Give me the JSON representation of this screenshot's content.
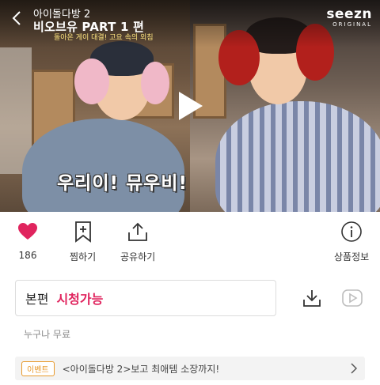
{
  "player": {
    "program_name": "아이돌다방 2",
    "episode_title": "비오브유 PART 1 편",
    "scene_caption": "돌아온 게이 대결! 고요 속의 외침",
    "subtitle_caption": "우리이! 뮤우비!",
    "brand": {
      "name": "seezn",
      "sub": "ORIGINAL"
    },
    "icons": {
      "back": "chevron-left-icon",
      "play": "play-icon"
    }
  },
  "actions": {
    "like": {
      "count": "186",
      "icon": "heart-icon",
      "color": "#e0245e"
    },
    "bookmark": {
      "label": "찜하기",
      "icon": "bookmark-plus-icon"
    },
    "share": {
      "label": "공유하기",
      "icon": "share-icon"
    },
    "product_info": {
      "label": "상품정보",
      "icon": "info-icon"
    }
  },
  "watch": {
    "type": "본편",
    "status": "시청가능",
    "status_color": "#e0245e",
    "download_icon": "download-icon",
    "play_icon": "play-outline-icon",
    "access_note": "누구나 무료"
  },
  "event": {
    "badge": "이벤트",
    "badge_color": "#e89a2c",
    "text": "<아이돌다방 2>보고 최애템 소장까지!",
    "chevron_icon": "chevron-right-icon"
  }
}
